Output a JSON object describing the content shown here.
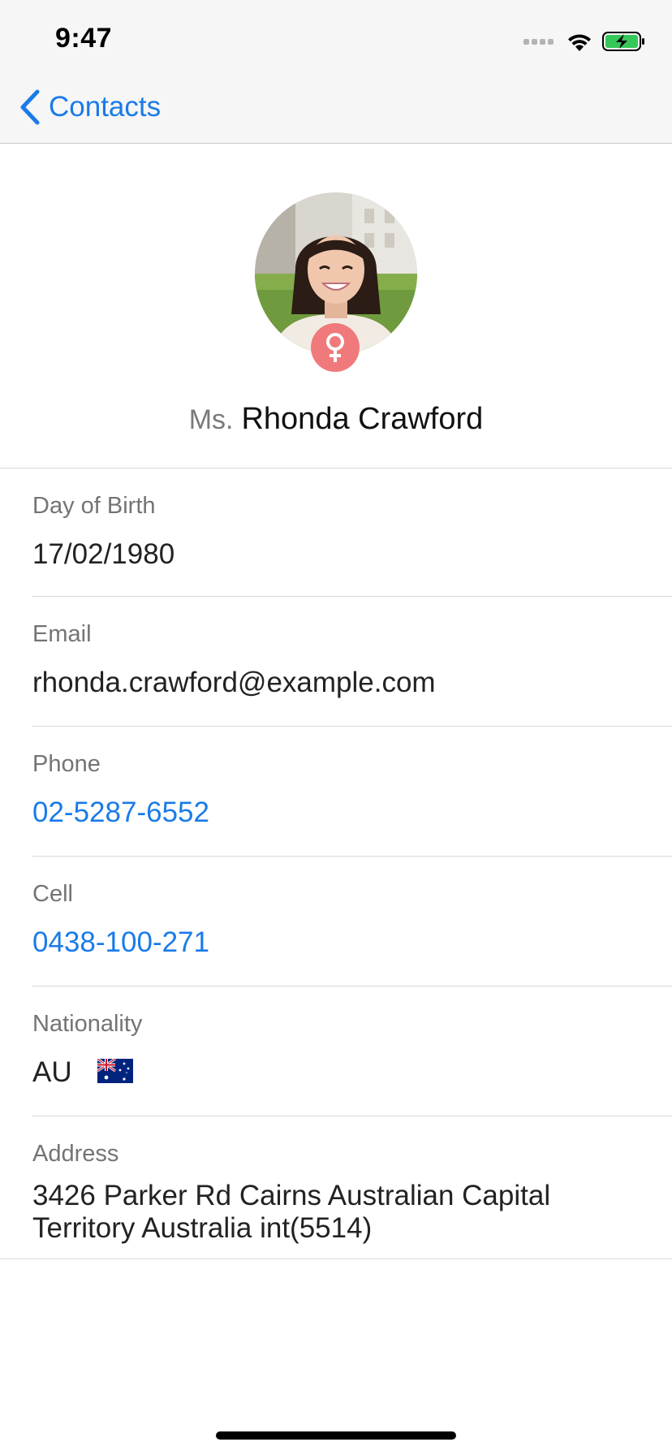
{
  "status_bar": {
    "time": "9:47",
    "battery_color": "#36c759"
  },
  "nav": {
    "back_label": "Contacts",
    "back_icon": "chevron-left-icon"
  },
  "profile": {
    "title": "Ms.",
    "name": "Rhonda Crawford",
    "gender_icon": "female-symbol-icon",
    "gender_badge_color": "#f07a7b"
  },
  "details": {
    "birth": {
      "label": "Day of Birth",
      "value": "17/02/1980"
    },
    "email": {
      "label": "Email",
      "value": "rhonda.crawford@example.com"
    },
    "phone": {
      "label": "Phone",
      "value": "02-5287-6552"
    },
    "cell": {
      "label": "Cell",
      "value": "0438-100-271"
    },
    "nationality": {
      "label": "Nationality",
      "value": "AU",
      "flag_icon": "australia-flag-icon"
    },
    "address": {
      "label": "Address",
      "value": "3426 Parker Rd Cairns Australian Capital Territory Australia int(5514)"
    }
  },
  "colors": {
    "accent": "#1a7be8",
    "label_gray": "#747474"
  }
}
